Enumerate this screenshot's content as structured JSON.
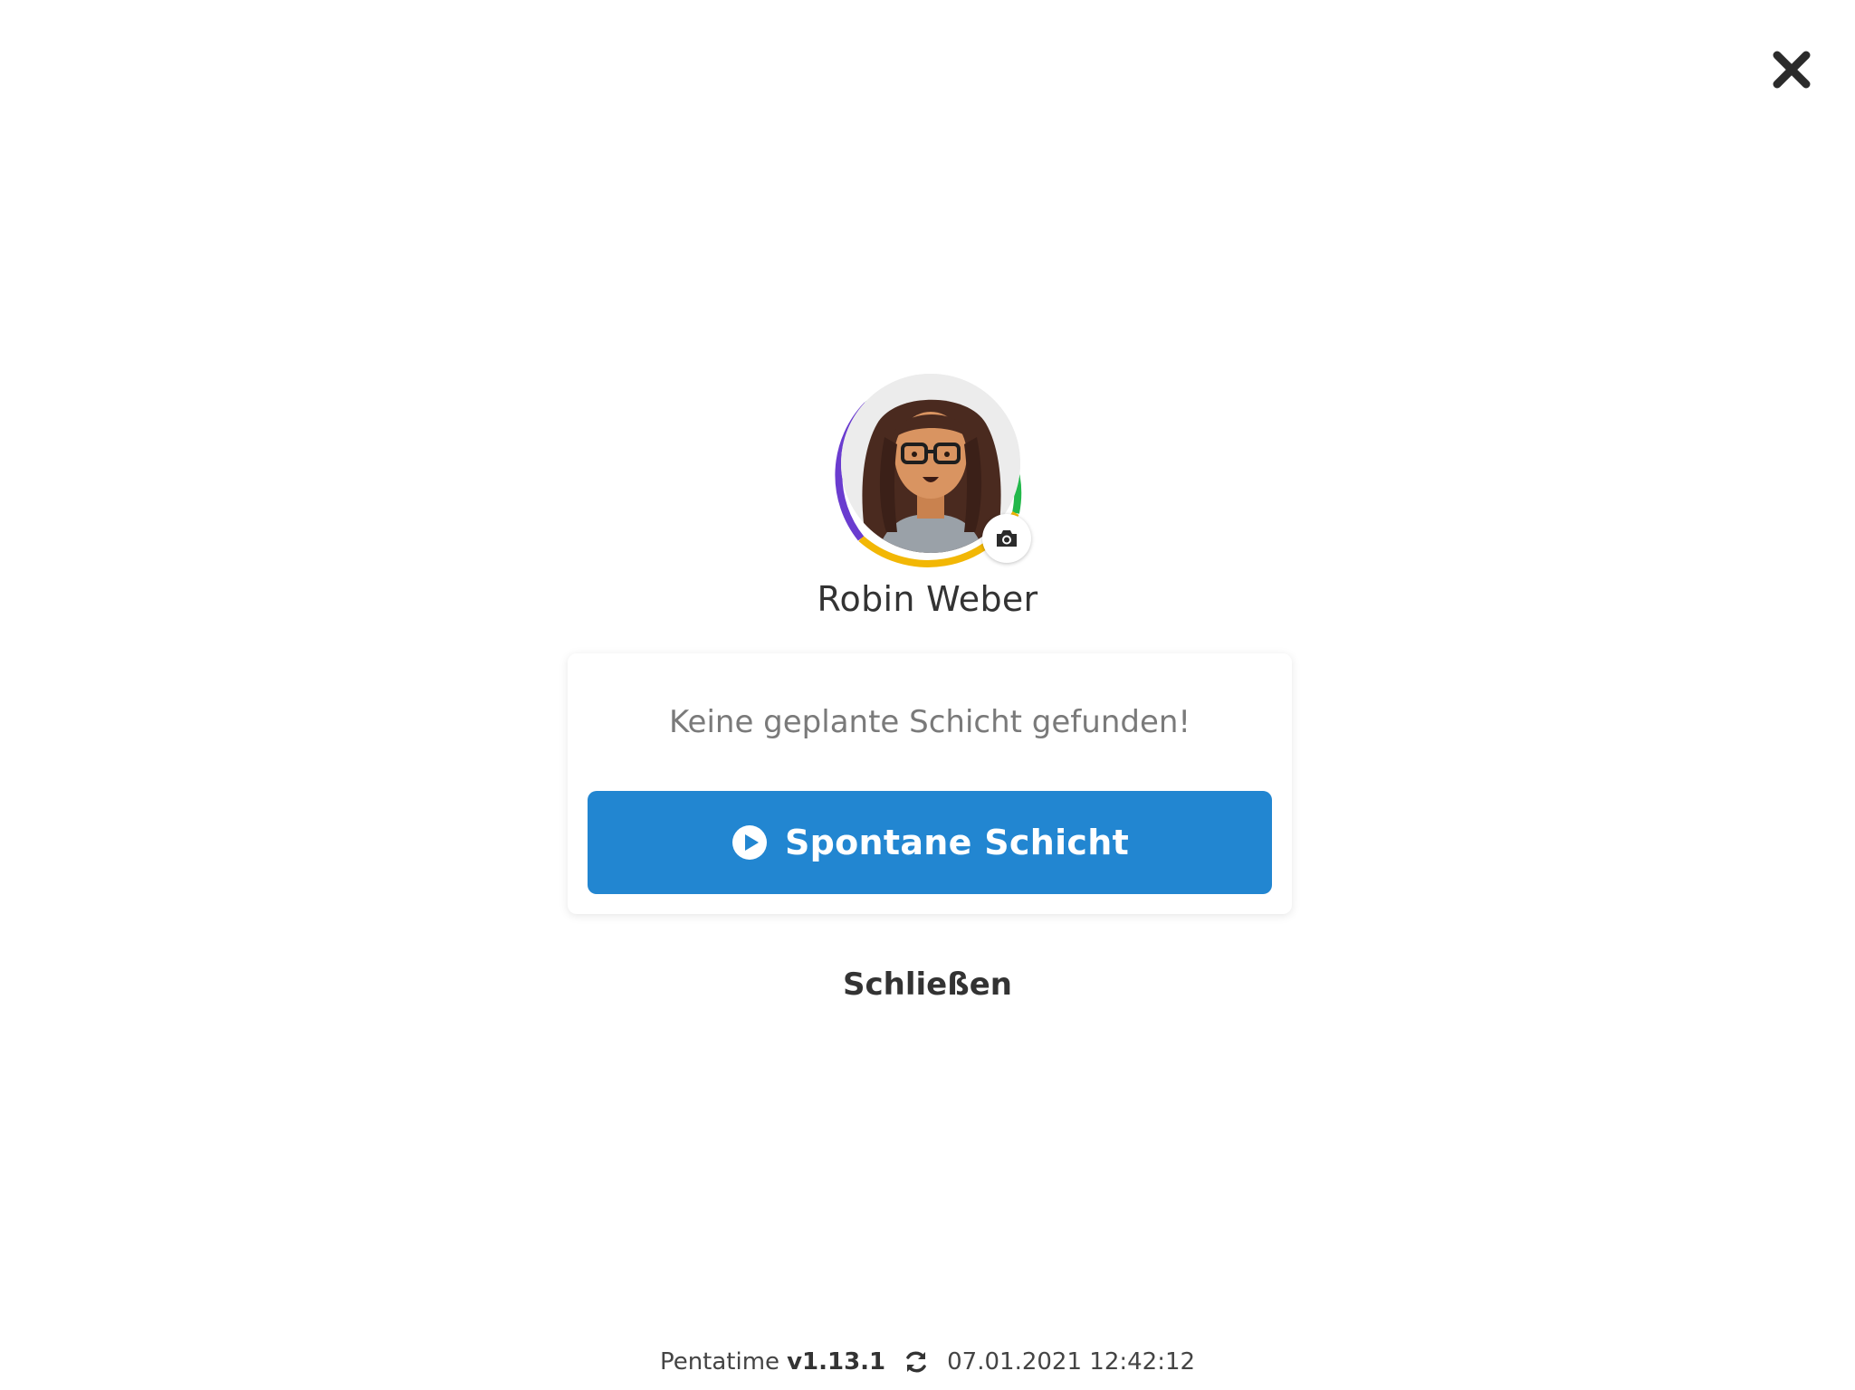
{
  "dialog": {
    "close_icon": "close-icon"
  },
  "profile": {
    "name": "Robin Weber",
    "avatar_icon": "avatar",
    "camera_icon": "camera-icon",
    "ring_colors": [
      "#22b84a",
      "#f2b705",
      "#6a3ccf"
    ]
  },
  "card": {
    "message": "Keine geplante Schicht gefunden!",
    "primary_button": {
      "label": "Spontane Schicht",
      "icon": "play-circle-icon",
      "color": "#2286d1"
    }
  },
  "actions": {
    "close_label": "Schließen"
  },
  "footer": {
    "app_name": "Pentatime",
    "version": "v1.13.1",
    "refresh_icon": "refresh-icon",
    "timestamp": "07.01.2021 12:42:12"
  }
}
